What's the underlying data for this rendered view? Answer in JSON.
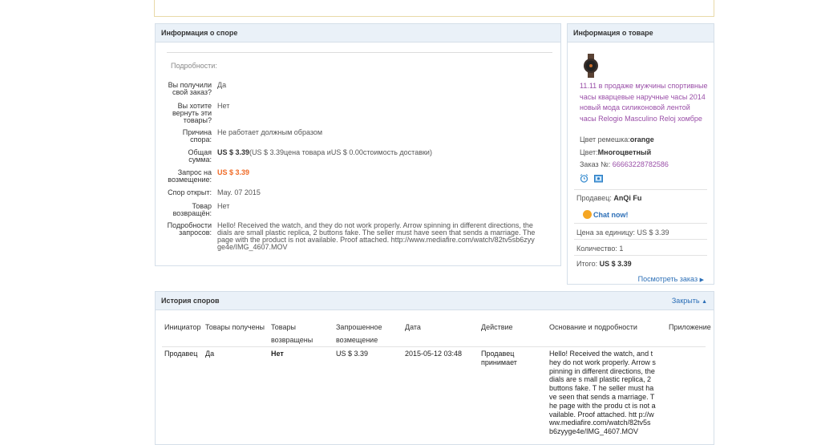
{
  "dispute_info": {
    "title": "Информация о споре",
    "details_label": "Подробности:",
    "rows": [
      {
        "label": "Вы получили свой заказ?",
        "value": "Да"
      },
      {
        "label": "Вы хотите вернуть эти товары?",
        "value": "Нет"
      },
      {
        "label": "Причина спора:",
        "value": "Не работает должным образом"
      },
      {
        "label": "Общая сумма:",
        "value_bold": "US $ 3.39",
        "value": "(US $ 3.39цена товара иUS $ 0.00стоимость доставки)"
      },
      {
        "label": "Запрос на возмещение:",
        "value": "US $ 3.39"
      },
      {
        "label": "Спор открыт:",
        "value": "May. 07 2015"
      },
      {
        "label": "Товар возвращён:",
        "value": "Нет"
      },
      {
        "label": "Подробности запросов:",
        "value": "Hello! Received the watch, and they do not work properly. Arrow spinning in different directions, the dials are small plastic replica, 2 buttons fake. The seller must have seen that sends a marriage. The page with the product is not available. Proof attached. http://www.mediafire.com/watch/82tv5sb6zyyge4e/IMG_4607.MOV"
      }
    ]
  },
  "product_info": {
    "title": "Информация о товаре",
    "product_title": "11.11 в продаже мужчины спортивные часы кварцевые наручные часы 2014 новый мода силиконовой лентой часы Relogio Masculino Reloj хомбре",
    "strap_color_label": "Цвет ремешка:",
    "strap_color_value": "orange",
    "color_label": "Цвет:",
    "color_value": "Многоцветный",
    "order_label": "Заказ №:",
    "order_value": "66663228782586",
    "seller_label": "Продавец:",
    "seller_value": "AnQi Fu",
    "chat_label": "Chat now!",
    "unit_price_label": "Цена за единицу:",
    "unit_price_value": "US $ 3.39",
    "qty_label": "Количество:",
    "qty_value": "1",
    "total_label": "Итого:",
    "total_value": "US $ 3.39",
    "view_order_label": "Посмотреть заказ",
    "colors": {
      "link": "#2c6fb7",
      "product_link": "#9a4fa8",
      "price_orange": "#f06a25"
    }
  },
  "history": {
    "title": "История споров",
    "collapse_label": "Закрыть",
    "columns": [
      "Инициатор",
      "Товары получены",
      "Товары возвращены",
      "Запрошенное возмещение",
      "Дата",
      "Действие",
      "Основание и подробности",
      "Приложение"
    ],
    "rows": [
      {
        "initiator": "Продавец",
        "received": "Да",
        "returned": "Нет",
        "refund": "US $ 3.39",
        "date": "2015-05-12 03:48",
        "action": "Продавец принимает",
        "reason": "Hello! Received the watch, and they do not work properly. Arrow spinning in different directions, the dials are s mall plastic replica, 2 buttons fake. T he seller must have seen that sends a marriage. The page with the produ ct is not available. Proof attached. htt p://www.mediafire.com/watch/82tv5s b6zyyge4e/IMG_4607.MOV",
        "attachment": ""
      }
    ]
  }
}
